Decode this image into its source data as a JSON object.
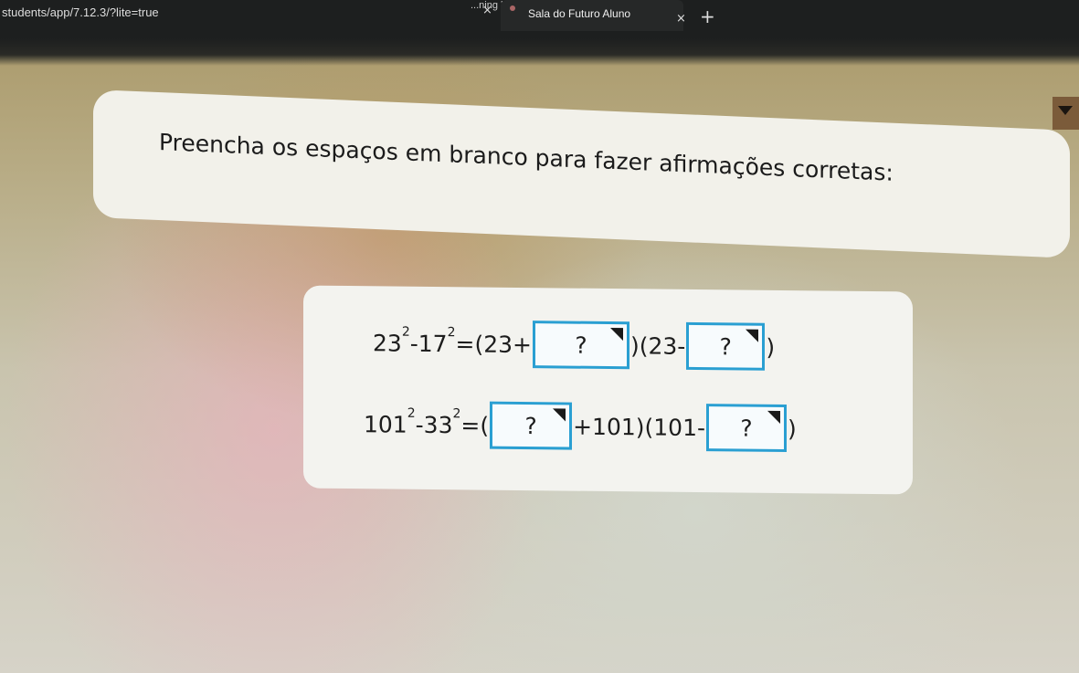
{
  "browser": {
    "url": "students/app/7.12.3/?lite=true",
    "prev_tab": "...ning learnin",
    "prev_tab_close": "×",
    "active_tab_title": "Sala do Futuro Aluno",
    "tab_close": "×",
    "new_tab": "+"
  },
  "instruction": "Preencha os espaços em branco para fazer afirmações corretas:",
  "blank_placeholder": "?",
  "equations": [
    {
      "p1": "23",
      "exp1": "2",
      "p2": "-17",
      "exp2": "2",
      "p3": "=(23+",
      "p4": ")(23-",
      "p5": ")"
    },
    {
      "p1": "101",
      "exp1": "2",
      "p2": "-33",
      "exp2": "2",
      "p3": "=(",
      "p4": "+101)(101-",
      "p5": ")"
    }
  ],
  "colors": {
    "blank_border": "#2a9fd2",
    "card_bg": "#f2f1ea"
  }
}
